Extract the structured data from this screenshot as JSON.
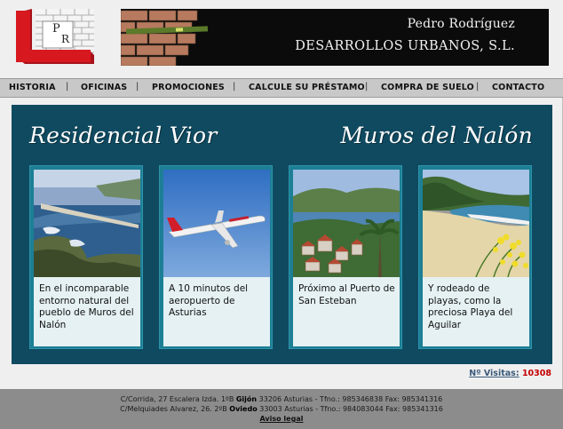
{
  "header": {
    "banner_name": "Pedro Rodríguez",
    "banner_company": "DESARROLLOS URBANOS, S.L.",
    "logo_initials": {
      "p": "P",
      "r": "R"
    }
  },
  "nav": {
    "items": [
      {
        "label": "HISTORIA"
      },
      {
        "label": "OFICINAS"
      },
      {
        "label": "PROMOCIONES"
      },
      {
        "label": "CALCULE SU PRÉSTAMO"
      },
      {
        "label": "COMPRA DE SUELO"
      },
      {
        "label": "CONTACTO"
      }
    ],
    "separator": "|"
  },
  "main": {
    "title_left": "Residencial Vior",
    "title_right": "Muros del Nalón",
    "cards": [
      {
        "image": "coastal-pier-photo",
        "text": "En el incomparable entorno natural del pueblo de Muros del Nalón"
      },
      {
        "image": "airplane-photo",
        "text": "A 10 minutos del aeropuerto de Asturias"
      },
      {
        "image": "harbor-town-photo",
        "text": "Próximo al Puerto de San Esteban"
      },
      {
        "image": "beach-photo",
        "text": "Y rodeado de playas, como la preciosa Playa del Aguilar"
      }
    ]
  },
  "visits": {
    "label": "Nº Visitas:",
    "count": "10308"
  },
  "footer": {
    "line1_pre": "C/Corrida, 27 Escalera Izda. 1ºB",
    "line1_city": "Gijón",
    "line1_post": "33206 Asturias - Tfno.: 985346838 Fax: 985341316",
    "line2_pre": "C/Melquiades Alvarez, 26. 2ºB",
    "line2_city": "Oviedo",
    "line2_post": "33003 Asturias - Tfno.: 984083044 Fax: 985341316",
    "legal": "Aviso legal"
  },
  "colors": {
    "panel": "#0f4a60",
    "card_frame": "#1d7f95",
    "card_text_bg": "#e5f1f3",
    "logo_red": "#d7191f",
    "visits_count": "#c40000"
  }
}
